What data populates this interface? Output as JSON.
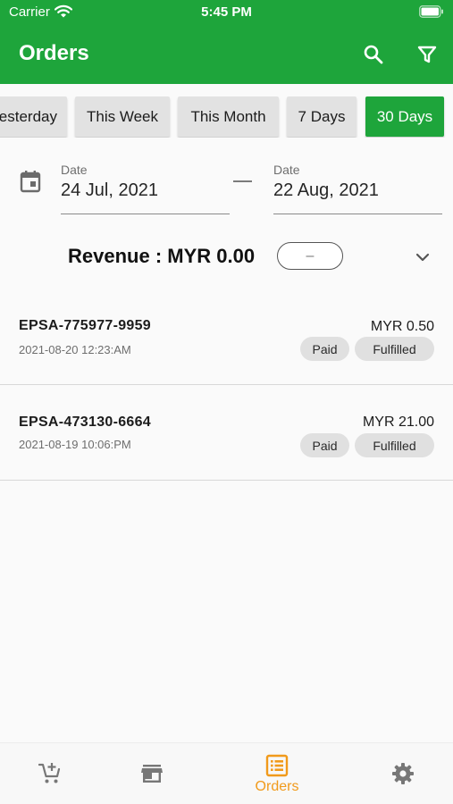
{
  "status_bar": {
    "carrier": "Carrier",
    "time": "5:45 PM"
  },
  "app_bar": {
    "title": "Orders",
    "search_icon": "search-icon",
    "filter_icon": "filter-icon"
  },
  "filter_chips": [
    {
      "label": "Yesterday",
      "active": false
    },
    {
      "label": "This Week",
      "active": false
    },
    {
      "label": "This Month",
      "active": false
    },
    {
      "label": "7 Days",
      "active": false
    },
    {
      "label": "30 Days",
      "active": true
    }
  ],
  "date_range": {
    "from": {
      "label": "Date",
      "value": "24 Jul, 2021"
    },
    "to": {
      "label": "Date",
      "value": "22 Aug, 2021"
    }
  },
  "revenue": {
    "text": "Revenue : MYR 0.00",
    "toggle_symbol": "–"
  },
  "orders": [
    {
      "id": "EPSA-775977-9959",
      "datetime": "2021-08-20 12:23:AM",
      "amount": "MYR 0.50",
      "payment_status": "Paid",
      "fulfillment_status": "Fulfilled"
    },
    {
      "id": "EPSA-473130-6664",
      "datetime": "2021-08-19 10:06:PM",
      "amount": "MYR 21.00",
      "payment_status": "Paid",
      "fulfillment_status": "Fulfilled"
    }
  ],
  "bottom_nav": [
    {
      "icon": "add-cart-icon",
      "label": "",
      "active": false
    },
    {
      "icon": "store-icon",
      "label": "",
      "active": false
    },
    {
      "icon": "orders-list-icon",
      "label": "Orders",
      "active": true
    },
    {
      "icon": "settings-gear-icon",
      "label": "",
      "active": false
    }
  ],
  "colors": {
    "primary": "#1ea53b",
    "active_tab": "#f19a1b",
    "chip": "#e2e2e2",
    "badge": "#e0e0e0"
  }
}
